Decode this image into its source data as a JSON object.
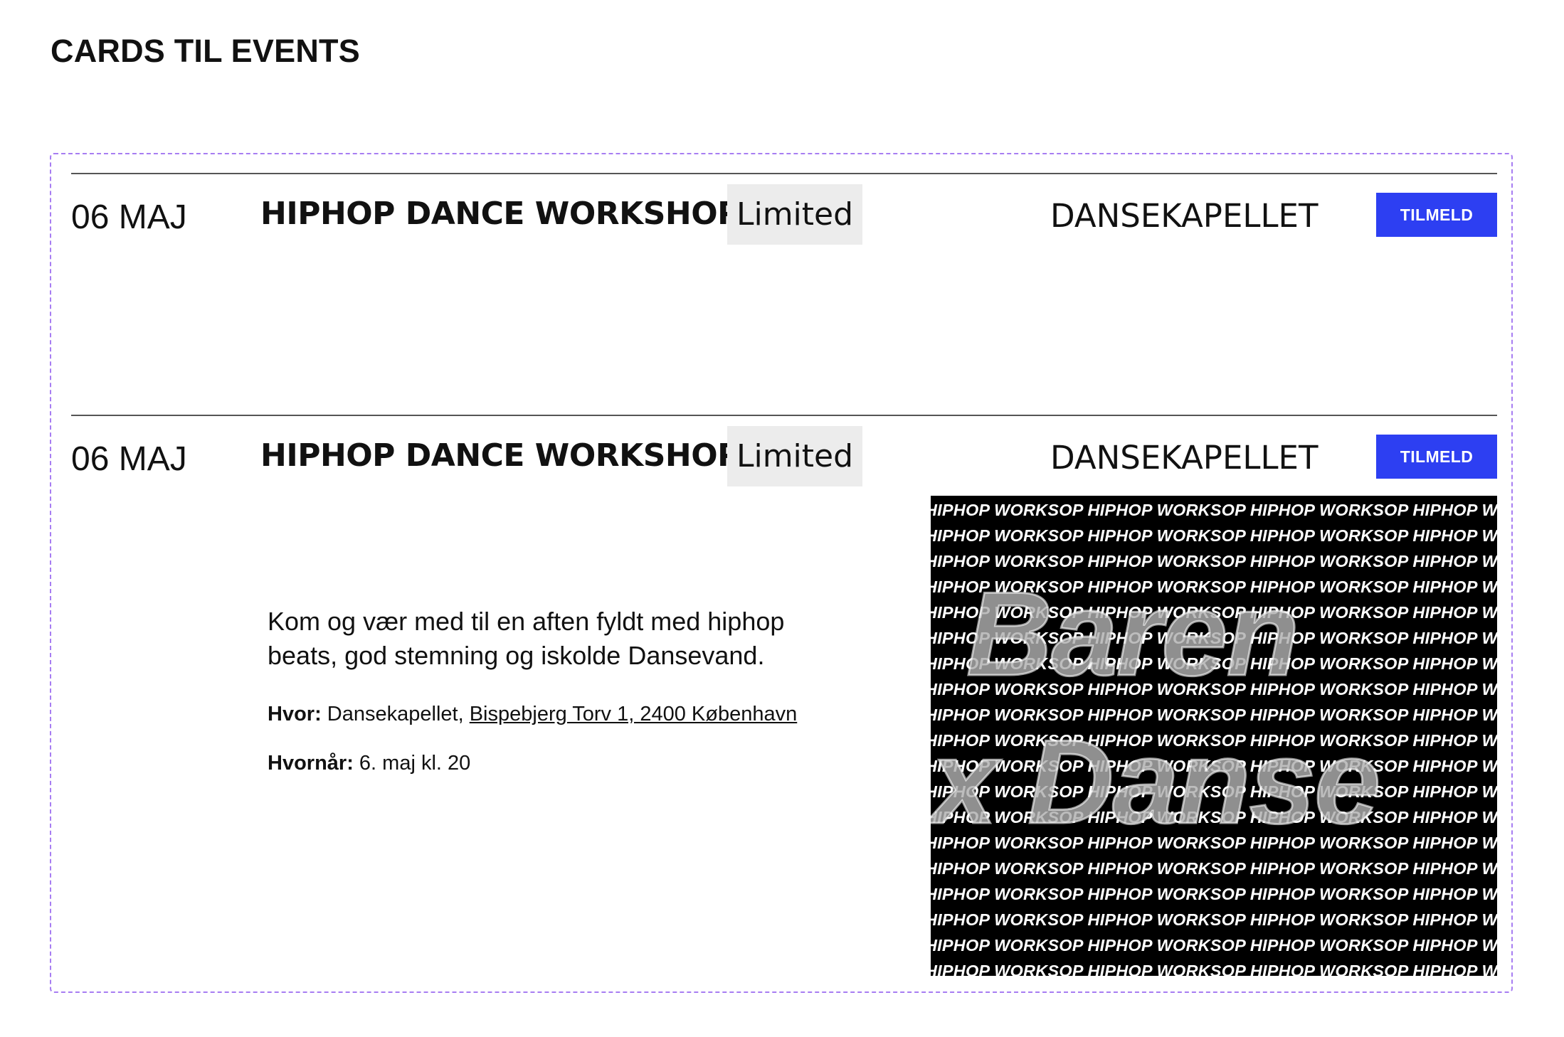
{
  "page": {
    "title": "CARDS TIL EVENTS"
  },
  "cards": [
    {
      "date": "06 MAJ",
      "title": "HIPHOP DANCE WORKSHOP",
      "badge": "Limited",
      "venue": "DANSEKAPELLET",
      "cta": "TILMELD",
      "expanded": false
    },
    {
      "date": "06 MAJ",
      "title": "HIPHOP DANCE WORKSHOP",
      "badge": "Limited",
      "venue": "DANSEKAPELLET",
      "cta": "TILMELD",
      "expanded": true,
      "description": "Kom og vær med til en aften fyldt med hiphop beats, god stemning og iskolde Dansevand.",
      "where_label": "Hvor:",
      "where_venue": "Dansekapellet,",
      "where_address": "Bispebjerg Torv 1, 2400 København",
      "when_label": "Hvornår:",
      "when_value": "6. maj kl. 20",
      "poster": {
        "pattern_text": "HIPHOP WORKSOP HIPHOP WORKSOP HIPHOP WORKSOP HIPHOP WORKSOP",
        "pattern_rows": 19,
        "headline_line1": "Baren",
        "headline_line2": "x Danse"
      }
    }
  ]
}
